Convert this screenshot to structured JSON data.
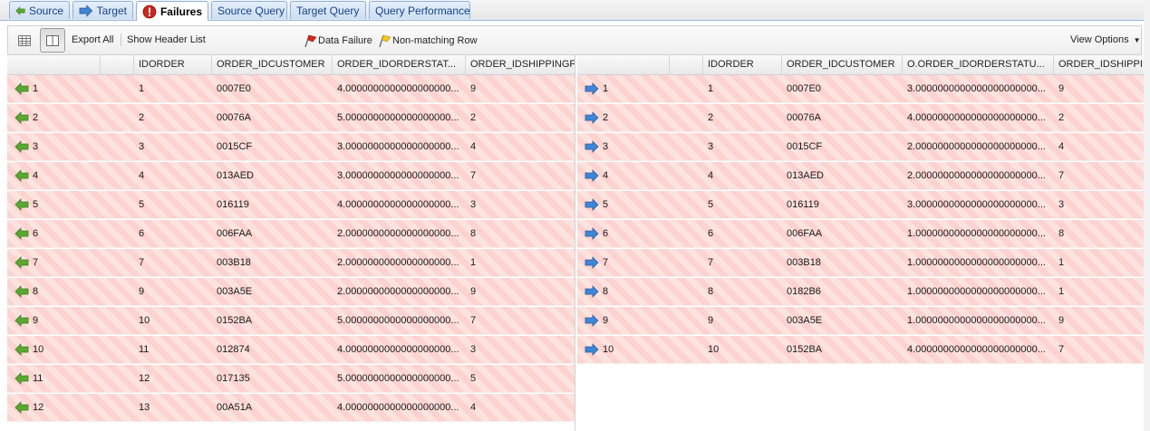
{
  "tabs": [
    {
      "label": "Source",
      "icon": "arrow-left-icon",
      "active": false
    },
    {
      "label": "Target",
      "icon": "arrow-right-icon",
      "active": false
    },
    {
      "label": "Failures",
      "icon": "error-icon",
      "active": true
    },
    {
      "label": "Source Query",
      "icon": "",
      "active": false
    },
    {
      "label": "Target Query",
      "icon": "",
      "active": false
    },
    {
      "label": "Query Performance",
      "icon": "",
      "active": false
    }
  ],
  "toolbar": {
    "export_label": "Export All",
    "header_list_label": "Show Header List",
    "data_failure_label": "Data Failure",
    "non_matching_label": "Non-matching Row",
    "view_options_label": "View Options"
  },
  "colors": {
    "failure_row_a": "#fcd3cf",
    "failure_row_b": "#fde3e0",
    "source_arrow": "#5aa832",
    "target_arrow": "#3f86d4"
  },
  "left_grid": {
    "columns": [
      "IDORDER",
      "ORDER_IDCUSTOMER",
      "ORDER_IDORDERSTAT...",
      "ORDER_IDSHIPPINGF"
    ],
    "rows": [
      {
        "num": "1",
        "idorder": "1",
        "idcustomer": "0007E0",
        "status": "4.0000000000000000000...",
        "shipping": "9"
      },
      {
        "num": "2",
        "idorder": "2",
        "idcustomer": "00076A",
        "status": "5.0000000000000000000...",
        "shipping": "2"
      },
      {
        "num": "3",
        "idorder": "3",
        "idcustomer": "0015CF",
        "status": "3.0000000000000000000...",
        "shipping": "4"
      },
      {
        "num": "4",
        "idorder": "4",
        "idcustomer": "013AED",
        "status": "3.0000000000000000000...",
        "shipping": "7"
      },
      {
        "num": "5",
        "idorder": "5",
        "idcustomer": "016119",
        "status": "4.0000000000000000000...",
        "shipping": "3"
      },
      {
        "num": "6",
        "idorder": "6",
        "idcustomer": "006FAA",
        "status": "2.0000000000000000000...",
        "shipping": "8"
      },
      {
        "num": "7",
        "idorder": "7",
        "idcustomer": "003B18",
        "status": "2.0000000000000000000...",
        "shipping": "1"
      },
      {
        "num": "8",
        "idorder": "9",
        "idcustomer": "003A5E",
        "status": "2.0000000000000000000...",
        "shipping": "9"
      },
      {
        "num": "9",
        "idorder": "10",
        "idcustomer": "0152BA",
        "status": "5.0000000000000000000...",
        "shipping": "7"
      },
      {
        "num": "10",
        "idorder": "11",
        "idcustomer": "012874",
        "status": "4.0000000000000000000...",
        "shipping": "3"
      },
      {
        "num": "11",
        "idorder": "12",
        "idcustomer": "017135",
        "status": "5.0000000000000000000...",
        "shipping": "5"
      },
      {
        "num": "12",
        "idorder": "13",
        "idcustomer": "00A51A",
        "status": "4.0000000000000000000...",
        "shipping": "4"
      }
    ]
  },
  "right_grid": {
    "columns": [
      "IDORDER",
      "ORDER_IDCUSTOMER",
      "O.ORDER_IDORDERSTATU...",
      "ORDER_IDSHIPPI"
    ],
    "rows": [
      {
        "num": "1",
        "idorder": "1",
        "idcustomer": "0007E0",
        "status": "3.0000000000000000000000...",
        "shipping": "9"
      },
      {
        "num": "2",
        "idorder": "2",
        "idcustomer": "00076A",
        "status": "4.0000000000000000000000...",
        "shipping": "2"
      },
      {
        "num": "3",
        "idorder": "3",
        "idcustomer": "0015CF",
        "status": "2.0000000000000000000000...",
        "shipping": "4"
      },
      {
        "num": "4",
        "idorder": "4",
        "idcustomer": "013AED",
        "status": "2.0000000000000000000000...",
        "shipping": "7"
      },
      {
        "num": "5",
        "idorder": "5",
        "idcustomer": "016119",
        "status": "3.0000000000000000000000...",
        "shipping": "3"
      },
      {
        "num": "6",
        "idorder": "6",
        "idcustomer": "006FAA",
        "status": "1.0000000000000000000000...",
        "shipping": "8"
      },
      {
        "num": "7",
        "idorder": "7",
        "idcustomer": "003B18",
        "status": "1.0000000000000000000000...",
        "shipping": "1"
      },
      {
        "num": "8",
        "idorder": "8",
        "idcustomer": "0182B6",
        "status": "1.0000000000000000000000...",
        "shipping": "1"
      },
      {
        "num": "9",
        "idorder": "9",
        "idcustomer": "003A5E",
        "status": "1.0000000000000000000000...",
        "shipping": "9"
      },
      {
        "num": "10",
        "idorder": "10",
        "idcustomer": "0152BA",
        "status": "4.0000000000000000000000...",
        "shipping": "7"
      }
    ]
  }
}
